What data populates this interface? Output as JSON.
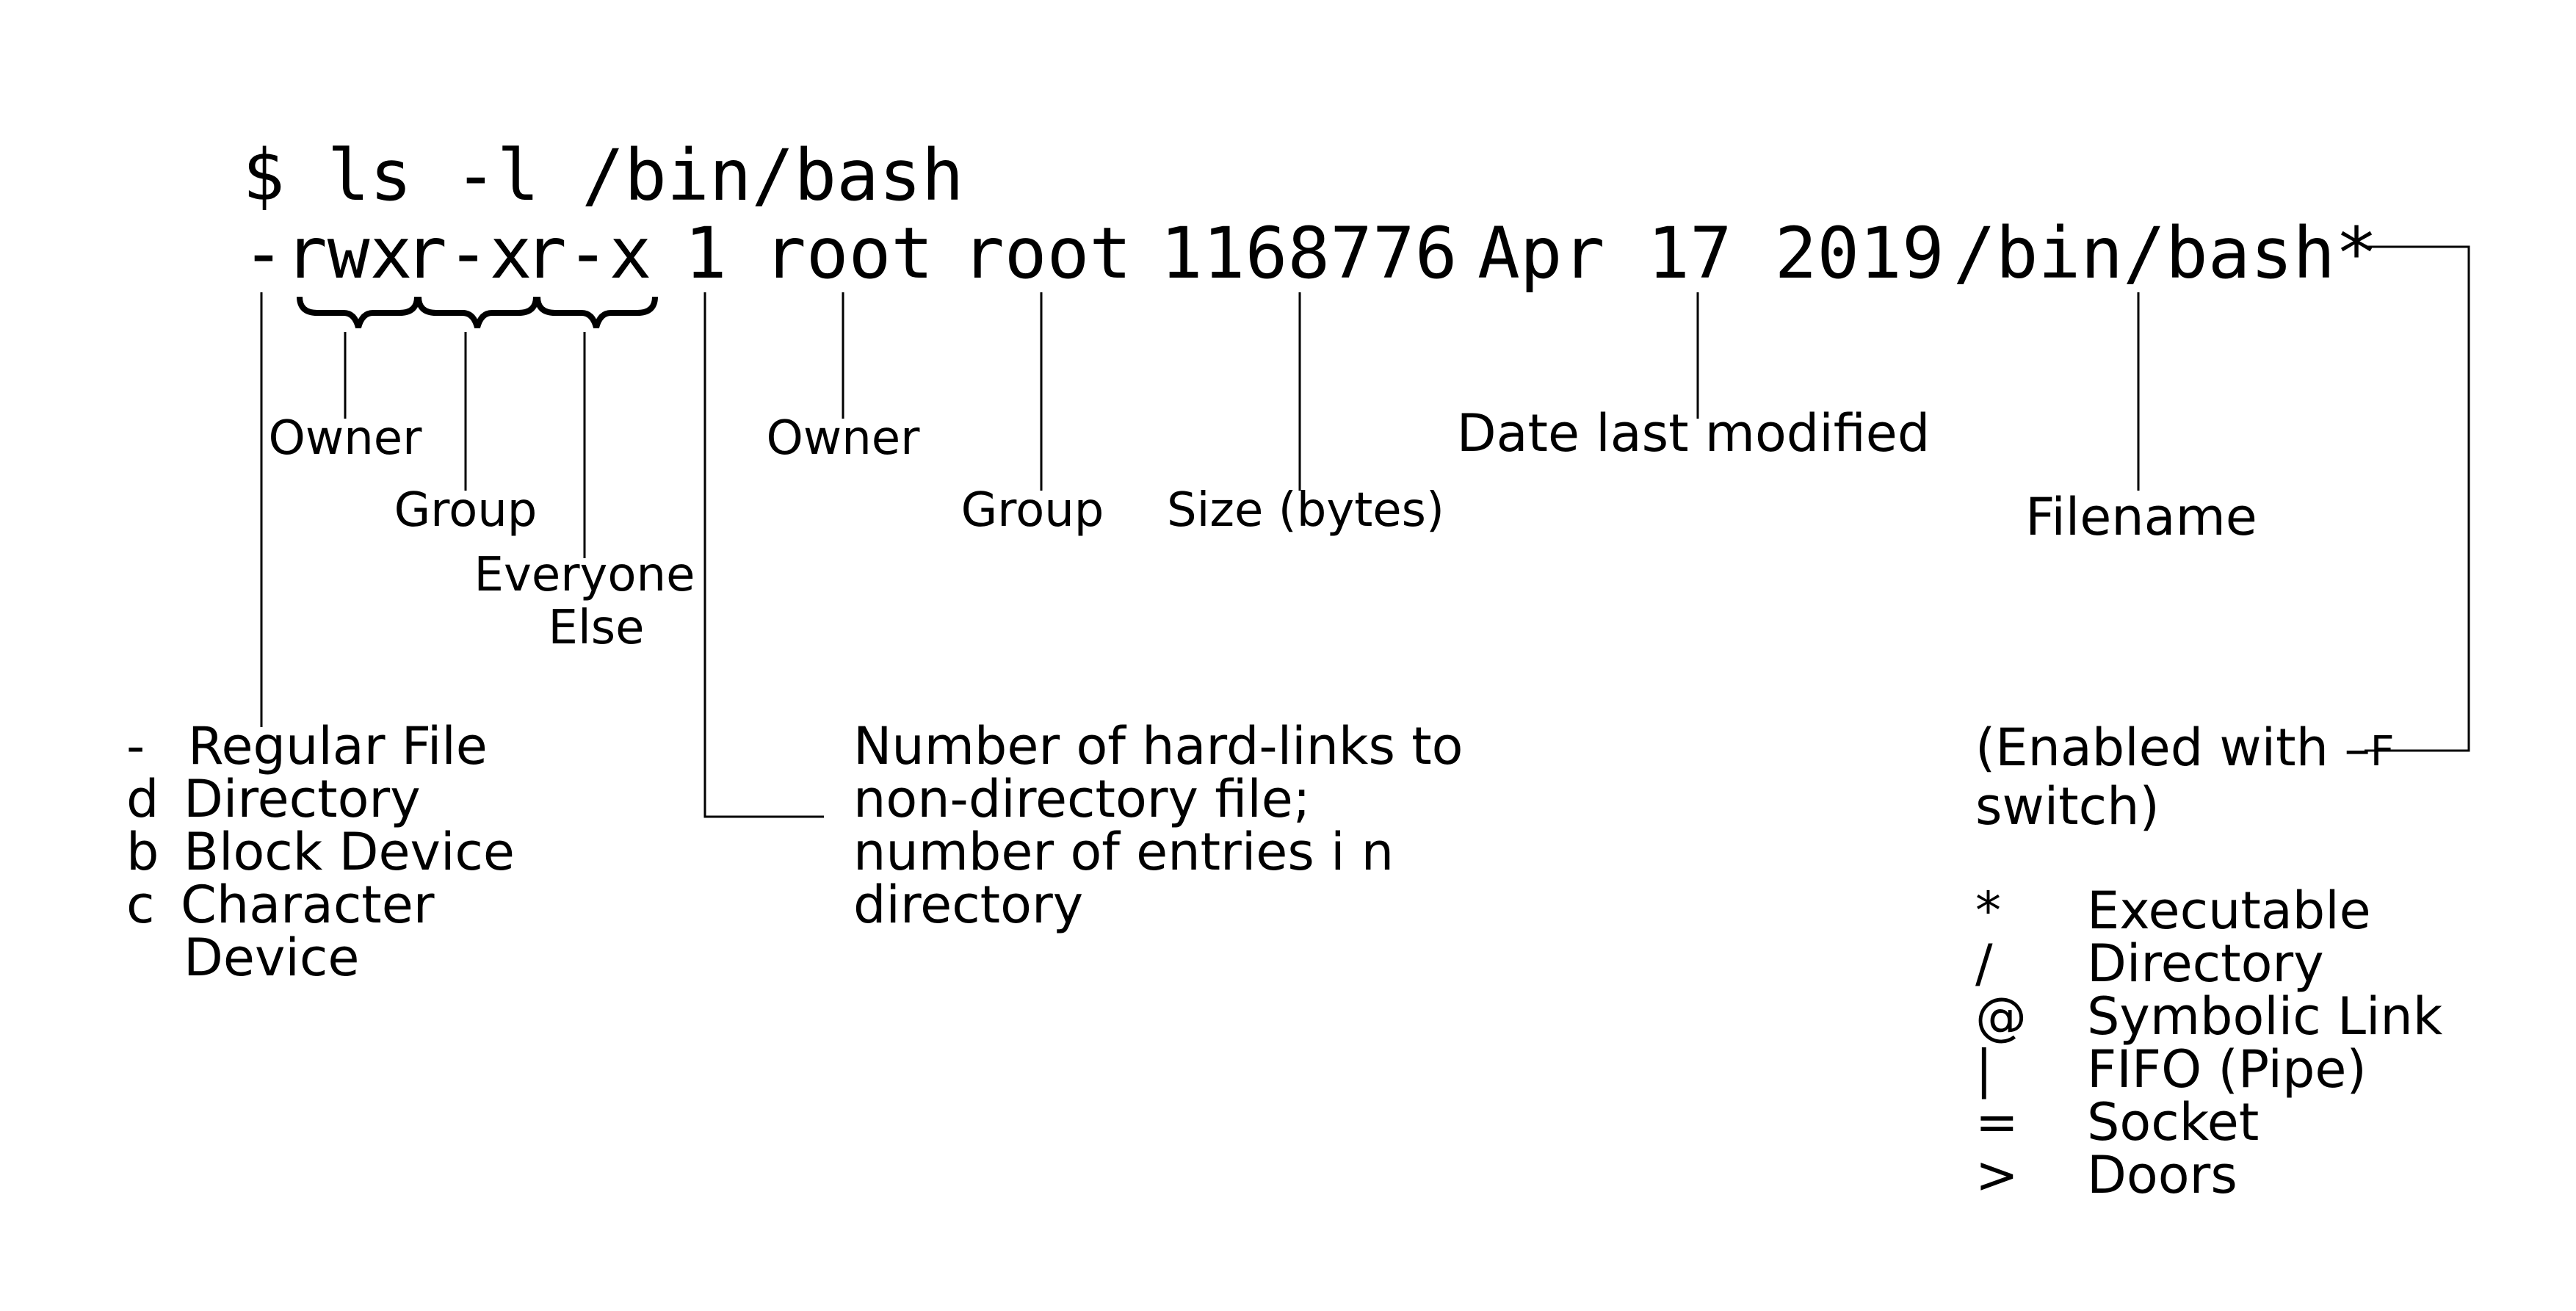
{
  "command": {
    "prompt": "$ ls -l /bin/bash",
    "type_char": "-",
    "perm_owner": "rwx",
    "perm_group": "r-x",
    "perm_other": "r-x",
    "links": "1",
    "owner": "root",
    "group": "root",
    "size": "1168776",
    "date": "Apr 17 2019",
    "filename": "/bin/bash*"
  },
  "labels": {
    "perm_owner": "Owner",
    "perm_group": "Group",
    "perm_other_1": "Everyone",
    "perm_other_2": "Else",
    "owner": "Owner",
    "group": "Group",
    "size": "Size (bytes)",
    "date": "Date last modified",
    "filename": "Filename"
  },
  "file_types": [
    {
      "code": "-",
      "desc": "Regular File"
    },
    {
      "code": "d",
      "desc": "Directory"
    },
    {
      "code": "b",
      "desc": "Block Device"
    },
    {
      "code": "c",
      "desc": "Character"
    },
    {
      "code": "",
      "desc": "Device"
    }
  ],
  "links_note": [
    "Number of hard-links to",
    "non-directory file;",
    "number of entries i n",
    "directory"
  ],
  "switch_note": {
    "prefix": "(Enabled with ",
    "switch": "−F",
    "line2": "switch)"
  },
  "indicators": [
    {
      "symbol": "*",
      "meaning": "Executable"
    },
    {
      "symbol": "/",
      "meaning": "Directory"
    },
    {
      "symbol": "@",
      "meaning": "Symbolic Link"
    },
    {
      "symbol": "|",
      "meaning": "FIFO (Pipe)"
    },
    {
      "symbol": "=",
      "meaning": "Socket"
    },
    {
      "symbol": ">",
      "meaning": "Doors"
    }
  ]
}
